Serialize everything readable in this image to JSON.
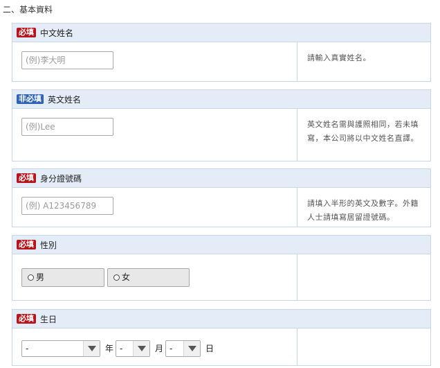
{
  "section": {
    "title": "二、基本資料"
  },
  "badges": {
    "required": "必填",
    "optional": "非必填"
  },
  "fields": {
    "chinese_name": {
      "label": "中文姓名",
      "placeholder": "(例)李大明",
      "note": "請輸入真實姓名。"
    },
    "english_name": {
      "label": "英文姓名",
      "placeholder": "(例)Lee",
      "note": "英文姓名需與護照相同，若未填寫，本公司將以中文姓名直譯。"
    },
    "id_number": {
      "label": "身分證號碼",
      "placeholder": "(例) A123456789",
      "note": "請填入半形的英文及數字。外籍人士請填寫居留證號碼。"
    },
    "gender": {
      "label": "性別",
      "options": [
        "男",
        "女"
      ]
    },
    "birthday": {
      "label": "生日",
      "year_value": "-",
      "month_value": "-",
      "day_value": "-",
      "year_unit": "年",
      "month_unit": "月",
      "day_unit": "日"
    }
  },
  "icons": {
    "radio": "radio-circle-icon",
    "dropdown": "chevron-down-icon"
  },
  "colors": {
    "required_badge": "#b8141c",
    "optional_badge": "#2e63b8",
    "header_bg": "#e4ecf8"
  }
}
